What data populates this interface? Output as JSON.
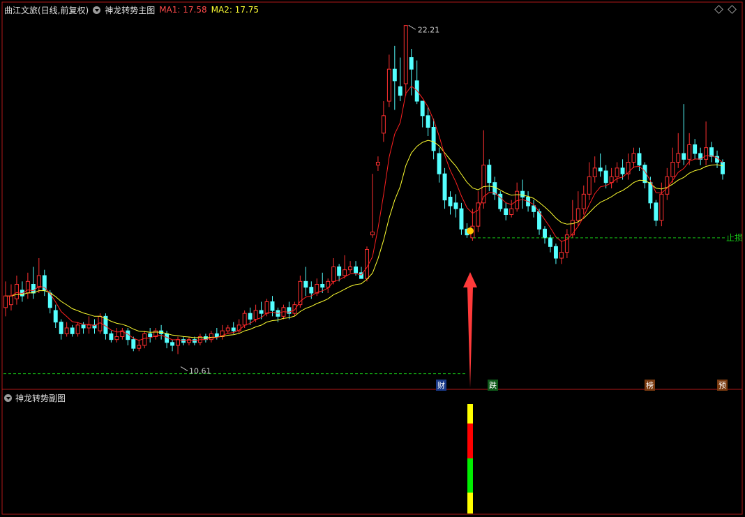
{
  "header": {
    "title": "曲江文旅(日线,前复权)",
    "indicator": "神龙转势主图",
    "ma1": "MA1: 17.58",
    "ma2": "MA2: 17.75"
  },
  "subchart": {
    "title": "神龙转势副图"
  },
  "price_labels": {
    "high": "22.21",
    "low": "10.61",
    "stop_loss": "止损"
  },
  "markers": {
    "cai": "财",
    "die": "跌",
    "bang": "榜",
    "yu": "预"
  },
  "colors": {
    "up": "#ff3030",
    "down": "#54ffff",
    "ma1": "#ff2020",
    "ma2": "#ffff30",
    "dashed": "#17c817",
    "border": "#b01818",
    "signal_dot": "#ffc800",
    "arrow": "#ff3a3a"
  },
  "chart_data": {
    "type": "candlestick",
    "price_range": [
      10.0,
      22.6
    ],
    "high": 22.21,
    "low": 10.61,
    "stop_loss_level": 14.9,
    "candles": [
      [
        12.5,
        12.9,
        12.2,
        13.4
      ],
      [
        12.6,
        12.9,
        12.4,
        13.3
      ],
      [
        12.8,
        13.3,
        12.6,
        13.6
      ],
      [
        13.1,
        12.9,
        12.7,
        13.4
      ],
      [
        13.0,
        13.4,
        12.8,
        13.7
      ],
      [
        13.3,
        13.0,
        12.8,
        13.9
      ],
      [
        13.2,
        13.6,
        13.0,
        14.2
      ],
      [
        13.6,
        13.1,
        12.9,
        13.8
      ],
      [
        13.0,
        12.5,
        12.3,
        13.1
      ],
      [
        12.4,
        12.0,
        11.8,
        12.6
      ],
      [
        12.0,
        11.6,
        11.4,
        12.1
      ],
      [
        11.6,
        11.8,
        11.5,
        12.0
      ],
      [
        11.8,
        11.6,
        11.5,
        11.9
      ],
      [
        11.6,
        11.9,
        11.5,
        12.0
      ],
      [
        11.9,
        11.8,
        11.6,
        12.0
      ],
      [
        11.8,
        11.9,
        11.6,
        12.2
      ],
      [
        11.9,
        11.8,
        11.6,
        12.1
      ],
      [
        11.7,
        12.2,
        11.6,
        12.3
      ],
      [
        12.2,
        11.6,
        11.4,
        12.3
      ],
      [
        11.6,
        11.4,
        11.3,
        11.7
      ],
      [
        11.4,
        11.5,
        11.3,
        11.8
      ],
      [
        11.5,
        11.7,
        11.4,
        11.8
      ],
      [
        11.7,
        11.4,
        11.2,
        11.8
      ],
      [
        11.4,
        11.1,
        11.0,
        11.5
      ],
      [
        11.1,
        11.2,
        11.0,
        11.4
      ],
      [
        11.2,
        11.6,
        11.1,
        11.7
      ],
      [
        11.6,
        11.5,
        11.3,
        11.8
      ],
      [
        11.5,
        11.7,
        11.4,
        11.8
      ],
      [
        11.7,
        11.6,
        11.4,
        11.9
      ],
      [
        11.6,
        11.3,
        11.1,
        11.7
      ],
      [
        11.3,
        11.2,
        11.0,
        11.4
      ],
      [
        11.2,
        11.4,
        10.9,
        11.5
      ],
      [
        11.4,
        11.3,
        11.2,
        11.5
      ],
      [
        11.3,
        11.4,
        11.2,
        11.5
      ],
      [
        11.4,
        11.3,
        11.2,
        11.5
      ],
      [
        11.3,
        11.5,
        11.2,
        11.6
      ],
      [
        11.5,
        11.4,
        11.3,
        11.6
      ],
      [
        11.4,
        11.6,
        11.3,
        11.7
      ],
      [
        11.6,
        11.5,
        11.4,
        11.8
      ],
      [
        11.5,
        11.7,
        11.4,
        11.9
      ],
      [
        11.7,
        11.8,
        11.6,
        11.9
      ],
      [
        11.8,
        11.7,
        11.6,
        12.0
      ],
      [
        11.7,
        11.9,
        11.6,
        12.1
      ],
      [
        11.9,
        12.3,
        11.8,
        12.4
      ],
      [
        12.3,
        12.1,
        11.9,
        12.5
      ],
      [
        12.1,
        12.4,
        12.0,
        12.6
      ],
      [
        12.4,
        12.3,
        12.1,
        12.7
      ],
      [
        12.3,
        12.7,
        12.2,
        12.8
      ],
      [
        12.7,
        12.4,
        12.2,
        12.9
      ],
      [
        12.4,
        12.2,
        12.0,
        12.5
      ],
      [
        12.2,
        12.5,
        12.1,
        12.6
      ],
      [
        12.5,
        12.3,
        12.1,
        12.7
      ],
      [
        12.3,
        12.6,
        12.2,
        12.7
      ],
      [
        12.6,
        13.4,
        12.5,
        13.6
      ],
      [
        13.4,
        13.2,
        12.9,
        13.9
      ],
      [
        13.2,
        13.0,
        12.8,
        13.4
      ],
      [
        13.0,
        13.3,
        12.9,
        13.5
      ],
      [
        13.3,
        13.2,
        13.0,
        13.7
      ],
      [
        13.2,
        13.4,
        13.0,
        13.5
      ],
      [
        13.4,
        13.9,
        13.3,
        14.2
      ],
      [
        13.9,
        13.6,
        13.4,
        14.0
      ],
      [
        13.6,
        13.8,
        13.5,
        14.3
      ],
      [
        13.8,
        13.9,
        13.7,
        14.1
      ],
      [
        13.9,
        13.7,
        13.6,
        14.1
      ],
      [
        13.7,
        13.5,
        13.5,
        13.9
      ],
      [
        13.5,
        14.5,
        13.4,
        14.6
      ],
      [
        15.0,
        15.1,
        14.9,
        17.1
      ],
      [
        17.4,
        17.5,
        17.2,
        17.7
      ],
      [
        18.5,
        19.1,
        18.2,
        19.6
      ],
      [
        19.6,
        20.7,
        19.4,
        21.2
      ],
      [
        20.7,
        20.3,
        19.3,
        21.5
      ],
      [
        20.1,
        19.8,
        19.6,
        21.1
      ],
      [
        20.2,
        22.2,
        19.8,
        22.2
      ],
      [
        21.1,
        20.7,
        19.8,
        21.4
      ],
      [
        20.3,
        19.6,
        19.5,
        21.0
      ],
      [
        19.6,
        19.1,
        18.7,
        19.6
      ],
      [
        19.1,
        18.7,
        18.4,
        19.4
      ],
      [
        18.7,
        17.9,
        17.6,
        19.0
      ],
      [
        17.8,
        17.1,
        16.8,
        18.0
      ],
      [
        17.1,
        16.2,
        15.9,
        17.3
      ],
      [
        16.3,
        16.0,
        15.7,
        16.5
      ],
      [
        16.1,
        15.9,
        15.6,
        16.4
      ],
      [
        15.9,
        15.2,
        15.0,
        16.1
      ],
      [
        15.2,
        15.0,
        14.9,
        15.4
      ],
      [
        14.9,
        15.3,
        14.8,
        15.9
      ],
      [
        15.3,
        16.1,
        15.1,
        16.5
      ],
      [
        16.1,
        17.4,
        15.9,
        18.6
      ],
      [
        17.4,
        16.8,
        16.5,
        17.6
      ],
      [
        16.8,
        16.4,
        16.2,
        17.0
      ],
      [
        16.4,
        15.9,
        15.8,
        16.5
      ],
      [
        15.9,
        15.7,
        15.5,
        16.1
      ],
      [
        15.7,
        15.9,
        15.6,
        16.2
      ],
      [
        15.9,
        16.5,
        15.8,
        16.8
      ],
      [
        16.5,
        16.3,
        15.9,
        16.9
      ],
      [
        16.3,
        16.0,
        15.8,
        16.5
      ],
      [
        16.0,
        15.8,
        15.6,
        16.2
      ],
      [
        15.8,
        15.2,
        15.0,
        15.9
      ],
      [
        15.2,
        14.9,
        14.7,
        15.3
      ],
      [
        14.9,
        14.6,
        14.4,
        15.0
      ],
      [
        14.6,
        14.2,
        14.0,
        14.7
      ],
      [
        14.2,
        14.4,
        14.0,
        14.8
      ],
      [
        14.4,
        15.0,
        14.2,
        15.2
      ],
      [
        15.0,
        15.5,
        14.9,
        16.2
      ],
      [
        15.5,
        15.9,
        15.3,
        16.5
      ],
      [
        15.9,
        16.4,
        15.7,
        16.7
      ],
      [
        16.4,
        17.0,
        16.2,
        17.5
      ],
      [
        17.0,
        17.3,
        16.8,
        17.7
      ],
      [
        17.3,
        17.2,
        17.0,
        17.8
      ],
      [
        17.2,
        16.8,
        16.6,
        17.4
      ],
      [
        16.8,
        17.0,
        16.6,
        17.3
      ],
      [
        17.0,
        17.3,
        16.8,
        17.5
      ],
      [
        17.3,
        17.1,
        16.9,
        17.6
      ],
      [
        17.1,
        17.5,
        16.9,
        17.8
      ],
      [
        17.5,
        17.8,
        17.3,
        18.0
      ],
      [
        17.8,
        17.4,
        17.2,
        18.0
      ],
      [
        17.4,
        16.8,
        16.6,
        17.5
      ],
      [
        16.8,
        16.1,
        15.9,
        17.0
      ],
      [
        16.1,
        15.5,
        15.3,
        16.2
      ],
      [
        15.5,
        16.4,
        15.3,
        16.8
      ],
      [
        16.4,
        17.0,
        16.2,
        17.3
      ],
      [
        17.0,
        17.5,
        16.8,
        18.0
      ],
      [
        17.5,
        17.8,
        17.3,
        18.5
      ],
      [
        17.8,
        17.6,
        17.4,
        19.5
      ],
      [
        17.6,
        18.1,
        17.4,
        18.5
      ],
      [
        18.1,
        17.8,
        17.6,
        18.3
      ],
      [
        17.8,
        17.6,
        17.4,
        18.0
      ],
      [
        17.6,
        18.0,
        17.4,
        18.9
      ],
      [
        18.0,
        17.7,
        17.5,
        18.2
      ],
      [
        17.7,
        17.5,
        17.3,
        17.9
      ],
      [
        17.5,
        17.1,
        16.9,
        17.6
      ]
    ]
  }
}
